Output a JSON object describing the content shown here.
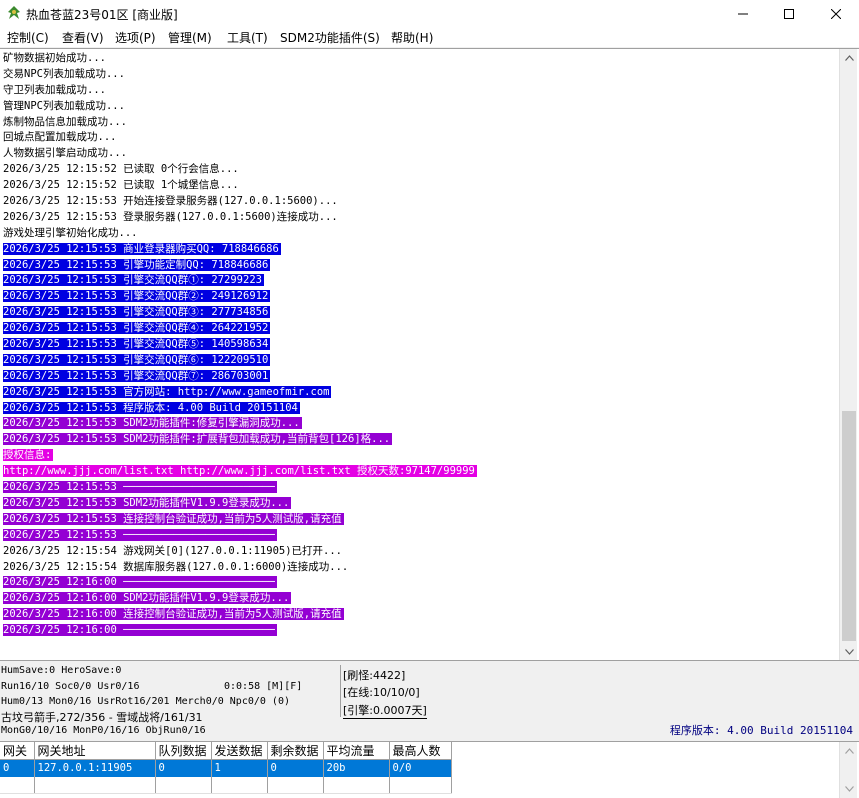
{
  "window": {
    "title": "热血苍蓝23号01区 [商业版]"
  },
  "menu": [
    {
      "label": "控制(C)"
    },
    {
      "label": "查看(V)"
    },
    {
      "label": "选项(P)"
    },
    {
      "label": "管理(M)"
    },
    {
      "label": "工具(T)"
    },
    {
      "label": "SDM2功能插件(S)"
    },
    {
      "label": "帮助(H)"
    }
  ],
  "log": {
    "lines": [
      {
        "text": "矿物数据初始成功...",
        "hl": ""
      },
      {
        "text": "交易NPC列表加载成功...",
        "hl": ""
      },
      {
        "text": "守卫列表加载成功...",
        "hl": ""
      },
      {
        "text": "管理NPC列表加载成功...",
        "hl": ""
      },
      {
        "text": "炼制物品信息加载成功...",
        "hl": ""
      },
      {
        "text": "回城点配置加载成功...",
        "hl": ""
      },
      {
        "text": "人物数据引擎启动成功...",
        "hl": ""
      },
      {
        "text": "2026/3/25 12:15:52 已读取 0个行会信息...",
        "hl": ""
      },
      {
        "text": "2026/3/25 12:15:52 已读取 1个城堡信息...",
        "hl": ""
      },
      {
        "text": "2026/3/25 12:15:53 开始连接登录服务器(127.0.0.1:5600)...",
        "hl": ""
      },
      {
        "text": "2026/3/25 12:15:53 登录服务器(127.0.0.1:5600)连接成功...",
        "hl": ""
      },
      {
        "text": "游戏处理引擎初始化成功...",
        "hl": ""
      },
      {
        "text": "2026/3/25 12:15:53 商业登录器购买QQ: 718846686",
        "hl": "blue"
      },
      {
        "text": "2026/3/25 12:15:53 引擎功能定制QQ: 718846686",
        "hl": "blue"
      },
      {
        "text": "2026/3/25 12:15:53 引擎交流QQ群①: 27299223",
        "hl": "blue"
      },
      {
        "text": "2026/3/25 12:15:53 引擎交流QQ群②: 249126912",
        "hl": "blue"
      },
      {
        "text": "2026/3/25 12:15:53 引擎交流QQ群③: 277734856",
        "hl": "blue"
      },
      {
        "text": "2026/3/25 12:15:53 引擎交流QQ群④: 264221952",
        "hl": "blue"
      },
      {
        "text": "2026/3/25 12:15:53 引擎交流QQ群⑤: 140598634",
        "hl": "blue"
      },
      {
        "text": "2026/3/25 12:15:53 引擎交流QQ群⑥: 122209510",
        "hl": "blue"
      },
      {
        "text": "2026/3/25 12:15:53 引擎交流QQ群⑦: 286703001",
        "hl": "blue"
      },
      {
        "text": "2026/3/25 12:15:53 官方网站: http://www.gameofmir.com",
        "hl": "blue"
      },
      {
        "text": "2026/3/25 12:15:53 程序版本: 4.00 Build 20151104",
        "hl": "blue"
      },
      {
        "text": "2026/3/25 12:15:53 SDM2功能插件:修复引擎漏洞成功...",
        "hl": "purple"
      },
      {
        "text": "2026/3/25 12:15:53 SDM2功能插件:扩展背包加载成功,当前背包[126]格...",
        "hl": "purple"
      },
      {
        "text": "授权信息:",
        "hl": "magenta"
      },
      {
        "text": "http://www.jjj.com/list.txt http://www.jjj.com/list.txt 授权天数:97147/99999",
        "hl": "magenta"
      },
      {
        "text": "2026/3/25 12:15:53 ────────────────────────",
        "hl": "purple"
      },
      {
        "text": "2026/3/25 12:15:53 SDM2功能插件V1.9.9登录成功...",
        "hl": "purple"
      },
      {
        "text": "2026/3/25 12:15:53 连接控制台验证成功,当前为5人测试版,请充值",
        "hl": "purple"
      },
      {
        "text": "2026/3/25 12:15:53 ────────────────────────",
        "hl": "purple"
      },
      {
        "text": "2026/3/25 12:15:54 游戏网关[0](127.0.0.1:11905)已打开...",
        "hl": ""
      },
      {
        "text": "2026/3/25 12:15:54 数据库服务器(127.0.0.1:6000)连接成功...",
        "hl": ""
      },
      {
        "text": "2026/3/25 12:16:00 ────────────────────────",
        "hl": "purple"
      },
      {
        "text": "2026/3/25 12:16:00 SDM2功能插件V1.9.9登录成功...",
        "hl": "purple"
      },
      {
        "text": "2026/3/25 12:16:00 连接控制台验证成功,当前为5人测试版,请充值",
        "hl": "purple"
      },
      {
        "text": "2026/3/25 12:16:00 ────────────────────────",
        "hl": "purple"
      }
    ]
  },
  "status": {
    "line1": "HumSave:0 HeroSave:0",
    "line2": "Run16/10 Soc0/0 Usr0/16",
    "time": "0:0:58 [M][F]",
    "line3": "Hum0/13 Mon0/16 UsrRot16/201 Merch0/0 Npc0/0 (0)",
    "line4": "古坟弓箭手,272/356 - 雪域战将/161/31",
    "line5": "MonG0/10/16 MonP0/16/16 ObjRun0/16",
    "refresh": "[刷怪:4422]",
    "online": "[在线:10/10/0]",
    "engine": "[引擎:0.0007天]",
    "version": "程序版本: 4.00 Build 20151104"
  },
  "gateway": {
    "headers": [
      "网关",
      "网关地址",
      "队列数据",
      "发送数据",
      "剩余数据",
      "平均流量",
      "最高人数"
    ],
    "rows": [
      [
        "0",
        "127.0.0.1:11905",
        "0",
        "1",
        "0",
        "20b",
        "0/0"
      ]
    ]
  }
}
